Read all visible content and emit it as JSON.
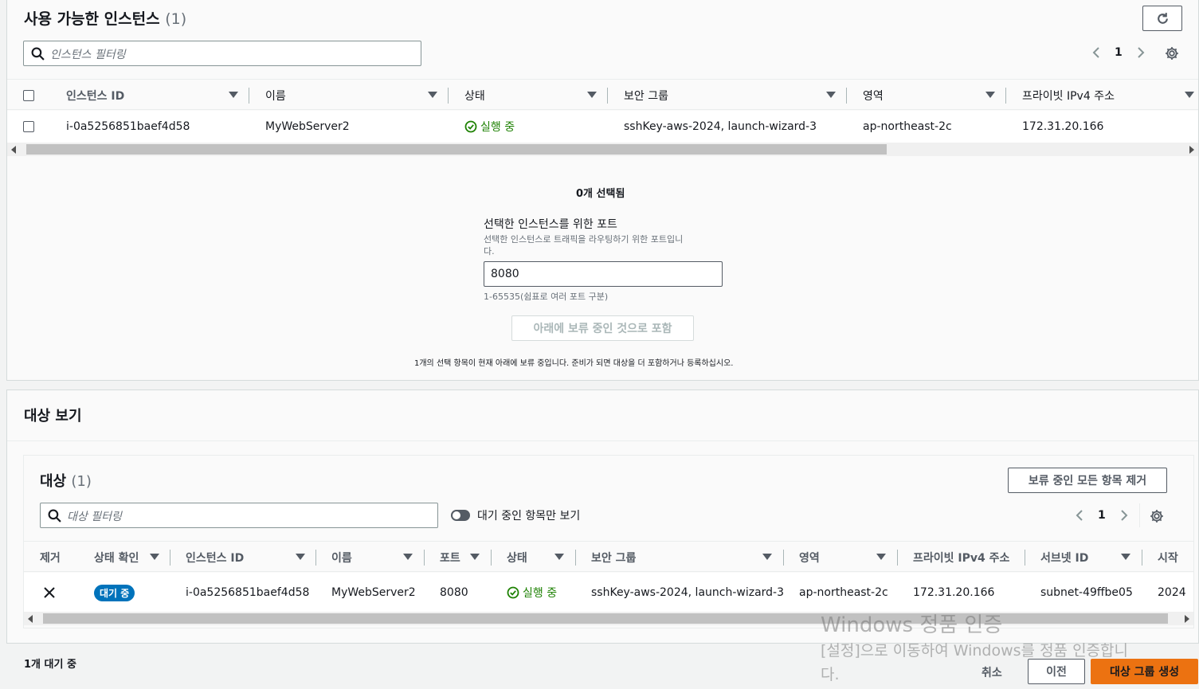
{
  "available": {
    "title": "사용 가능한 인스턴스",
    "count": "(1)",
    "search_placeholder": "인스턴스 필터링",
    "page": "1",
    "columns": [
      "인스턴스 ID",
      "이름",
      "상태",
      "보안 그룹",
      "영역",
      "프라이빗 IPv4 주소"
    ],
    "row": {
      "instance_id": "i-0a5256851baef4d58",
      "name": "MyWebServer2",
      "state": "실행 중",
      "security_group": "sshKey-aws-2024, launch-wizard-3",
      "zone": "ap-northeast-2c",
      "private_ip": "172.31.20.166"
    }
  },
  "selection": {
    "selected_count": "0개 선택됨",
    "port_label": "선택한 인스턴스를 위한 포트",
    "port_desc_line1": "선택한 인스턴스로 트래픽을 라우팅하기 위한 포트입니",
    "port_desc_line2": "다.",
    "port_value": "8080",
    "port_hint": "1-65535(쉼표로 여러 포트 구분)",
    "include_button": "아래에 보류 중인 것으로 포함",
    "pending_note": "1개의 선택 항목이 현재 아래에 보류 중입니다. 준비가 되면 대상을 더 포함하거나 등록하십시오."
  },
  "review": {
    "title": "대상 보기",
    "targets_title": "대상",
    "targets_count": "(1)",
    "remove_all_button": "보류 중인 모든 항목 제거",
    "search_placeholder": "대상 필터링",
    "toggle_label": "대기 중인 항목만 보기",
    "page": "1",
    "columns": [
      "제거",
      "상태 확인",
      "인스턴스 ID",
      "이름",
      "포트",
      "상태",
      "보안 그룹",
      "영역",
      "프라이빗 IPv4 주소",
      "서브넷 ID",
      "시작"
    ],
    "row": {
      "health": "대기 중",
      "instance_id": "i-0a5256851baef4d58",
      "name": "MyWebServer2",
      "port": "8080",
      "state": "실행 중",
      "security_group": "sshKey-aws-2024, launch-wizard-3",
      "zone": "ap-northeast-2c",
      "private_ip": "172.31.20.166",
      "subnet": "subnet-49ffbe05",
      "launch": "2024"
    }
  },
  "footer": {
    "pending": "1개 대기 중",
    "cancel": "취소",
    "previous": "이전",
    "create": "대상 그룹 생성"
  },
  "watermark": {
    "line1": "Windows 정품 인증",
    "line2": "[설정]으로 이동하여 Windows를 정품 인증합니",
    "line3": "다."
  },
  "colors": {
    "primary": "#ec7211",
    "success": "#1d8102",
    "badge": "#0073bb"
  }
}
